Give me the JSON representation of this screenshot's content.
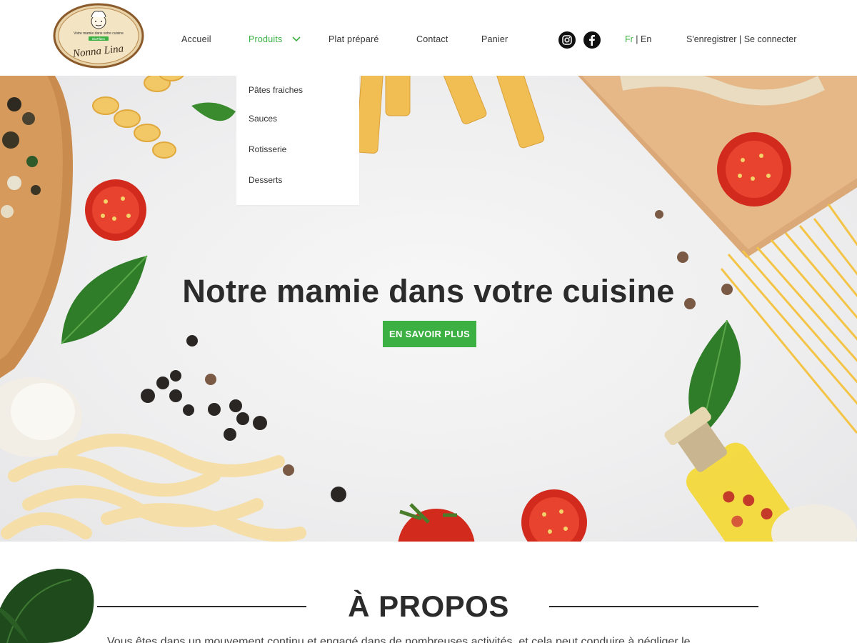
{
  "brand": {
    "logo_tagline": "Votre mamie dans votre cuisine",
    "logo_badge": "BioPâtes",
    "logo_name": "Nonna Lina"
  },
  "nav": {
    "items": [
      {
        "label": "Accueil"
      },
      {
        "label": "Produits"
      },
      {
        "label": "Plat préparé"
      },
      {
        "label": "Contact"
      },
      {
        "label": "Panier"
      }
    ],
    "active": "Produits"
  },
  "social": {
    "instagram_icon": "instagram-icon",
    "facebook_icon": "facebook-icon"
  },
  "language": {
    "fr": "Fr",
    "separator": "|",
    "en": "En",
    "active": "Fr"
  },
  "account": {
    "register": "S'enregistrer",
    "separator": "|",
    "login": "Se connecter"
  },
  "dropdown": {
    "items": [
      {
        "label": "Pâtes fraiches"
      },
      {
        "label": "Sauces"
      },
      {
        "label": "Rotisserie"
      },
      {
        "label": "Desserts"
      }
    ]
  },
  "hero": {
    "title": "Notre mamie dans votre cuisine",
    "cta": "EN SAVOIR PLUS"
  },
  "about": {
    "title": "À PROPOS",
    "text": "Vous êtes dans un mouvement continu et engagé dans de nombreuses activités, et cela peut conduire à négliger le"
  },
  "colors": {
    "accent": "#3cb043",
    "text": "#333333",
    "heading": "#2b2b2b"
  }
}
